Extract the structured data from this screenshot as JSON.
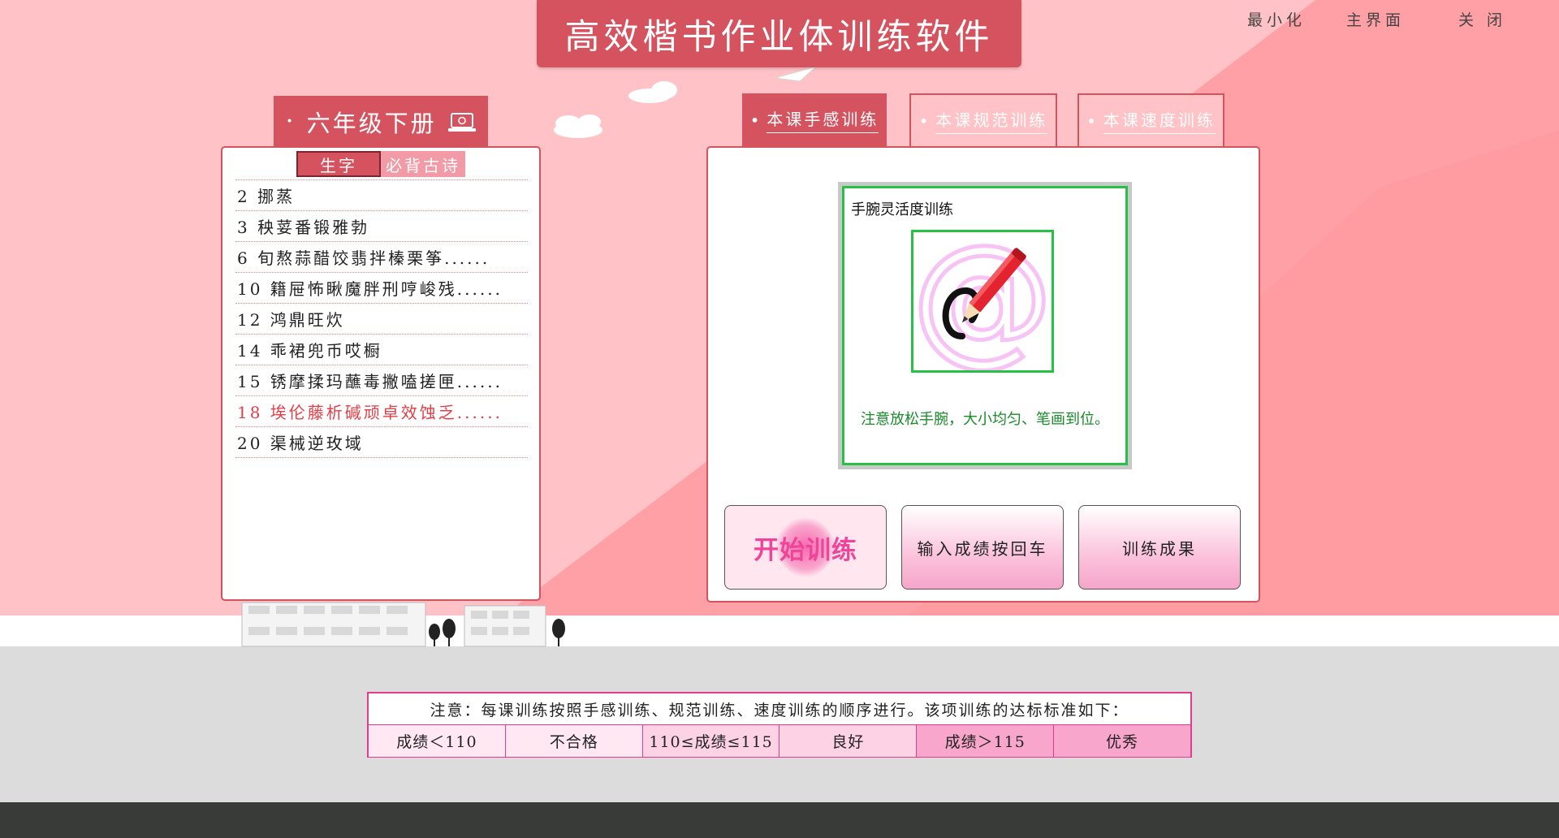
{
  "app": {
    "title": "高效楷书作业体训练软件"
  },
  "window_controls": {
    "minimize": "最小化",
    "main": "主界面",
    "close": "关 闭"
  },
  "grade": {
    "label": "六年级下册"
  },
  "sub_tabs": {
    "characters": "生字",
    "poems": "必背古诗"
  },
  "lessons": [
    {
      "text": "2 挪蒸",
      "highlighted": false
    },
    {
      "text": "3 秧荽番锻雅勃",
      "highlighted": false
    },
    {
      "text": "6 旬熬蒜醋饺翡拌榛栗筝......",
      "highlighted": false
    },
    {
      "text": "10 籍屉怖瞅魔胖刑哼峻残......",
      "highlighted": false
    },
    {
      "text": "12 鸿鼎旺炊",
      "highlighted": false
    },
    {
      "text": "14 乖裙兜币哎橱",
      "highlighted": false
    },
    {
      "text": "15 锈摩揉玛蘸毒撇嗑搓匣......",
      "highlighted": false
    },
    {
      "text": "18 埃伦藤析碱顽卓效蚀乏......",
      "highlighted": true
    },
    {
      "text": "20 渠械逆玫域",
      "highlighted": false
    }
  ],
  "tabs": [
    {
      "label": "本课手感训练",
      "active": true
    },
    {
      "label": "本课规范训练",
      "active": false
    },
    {
      "label": "本课速度训练",
      "active": false
    }
  ],
  "training": {
    "title": "手腕灵活度训练",
    "hint": "注意放松手腕，大小均匀、笔画到位。",
    "icon": "pencil-at-icon"
  },
  "actions": {
    "start": "开始训练",
    "score": "输入成绩按回车",
    "result": "训练成果"
  },
  "notice": {
    "header": "注意：每课训练按照手感训练、规范训练、速度训练的顺序进行。该项训练的达标标准如下：",
    "cells": [
      "成绩＜110",
      "不合格",
      "110≤成绩≤115",
      "良好",
      "成绩＞115",
      "优秀"
    ]
  },
  "colors": {
    "accent": "#d4535f",
    "background": "#ffc2c6",
    "green": "#25c245",
    "pink": "#f0449a"
  }
}
